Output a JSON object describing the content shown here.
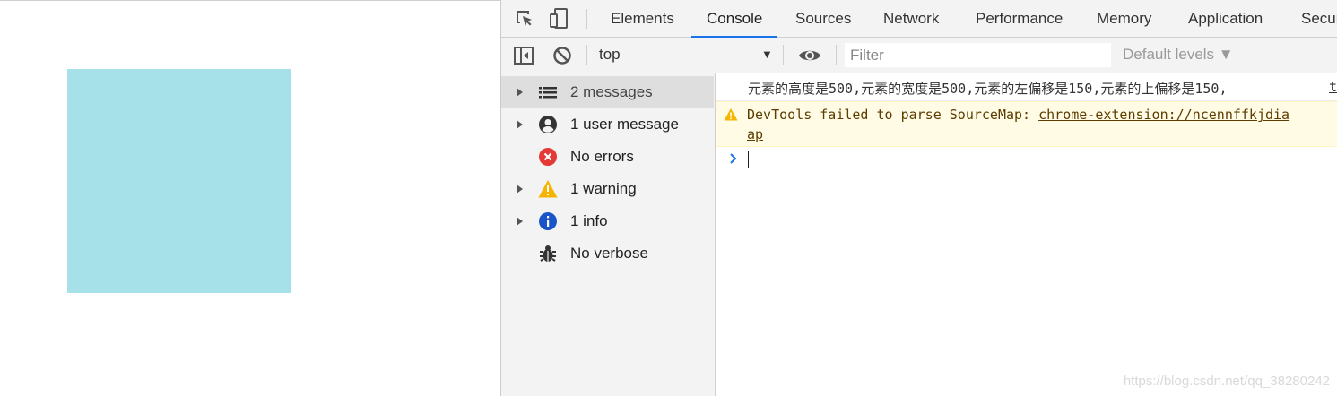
{
  "page": {
    "box_color": "#a6e0e9"
  },
  "devtools": {
    "tabs": [
      "Elements",
      "Console",
      "Sources",
      "Network",
      "Performance",
      "Memory",
      "Application",
      "Secur"
    ],
    "active_tab": "Console",
    "accent": "#1a73e8",
    "toolbar": {
      "context": "top",
      "filter_placeholder": "Filter",
      "levels": "Default levels ▼"
    },
    "sidebar": {
      "items": [
        {
          "label": "2 messages",
          "icon": "list-icon",
          "selected": true
        },
        {
          "label": "1 user message",
          "icon": "user-icon"
        },
        {
          "label": "No errors",
          "icon": "error-icon",
          "color": "#e53935"
        },
        {
          "label": "1 warning",
          "icon": "warning-icon",
          "color": "#f4b400"
        },
        {
          "label": "1 info",
          "icon": "info-icon",
          "color": "#1a54c9"
        },
        {
          "label": "No verbose",
          "icon": "bug-icon"
        }
      ]
    },
    "console": {
      "log_text": "元素的高度是500,元素的宽度是500,元素的左偏移是150,元素的上偏移是150,",
      "log_source": "t",
      "warning_prefix": "DevTools failed to parse SourceMap: ",
      "warning_link": "chrome-extension://ncennffkjdia",
      "warning_link_wrap": "ap"
    }
  },
  "watermark": "https://blog.csdn.net/qq_38280242"
}
